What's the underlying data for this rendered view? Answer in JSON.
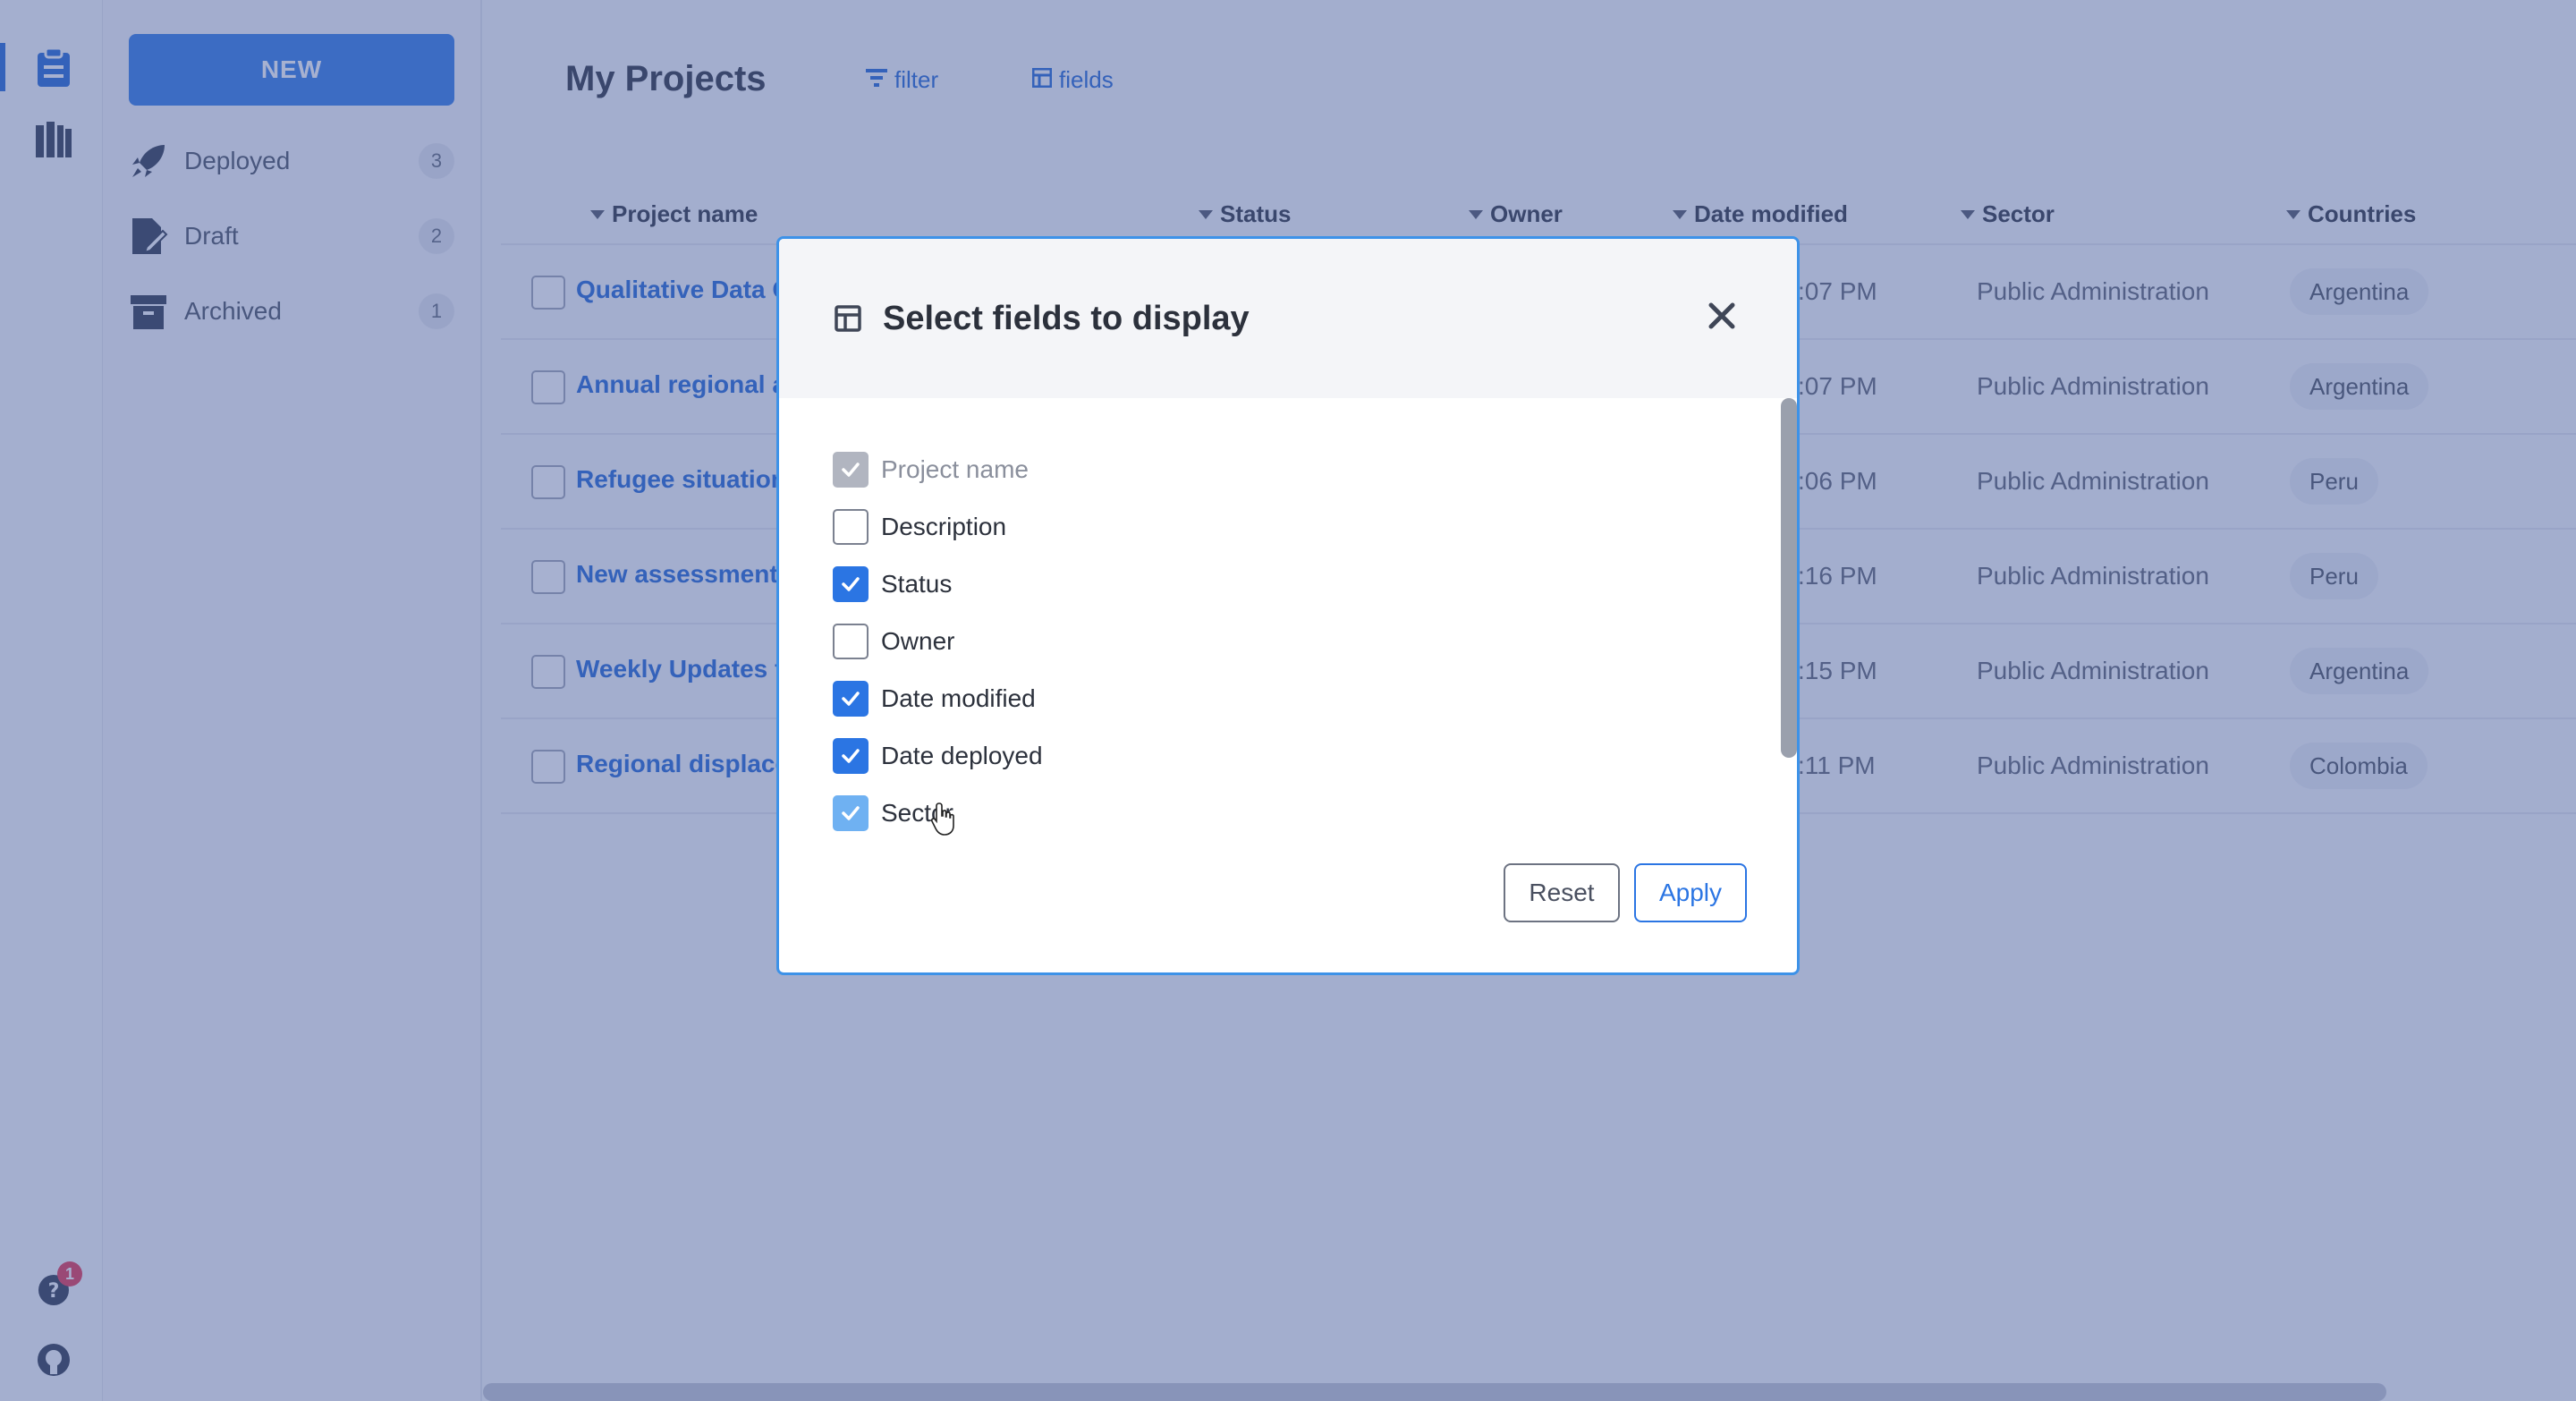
{
  "sidebar": {
    "new_label": "NEW",
    "items": [
      {
        "label": "Deployed",
        "count": "3",
        "icon": "rocket-icon"
      },
      {
        "label": "Draft",
        "count": "2",
        "icon": "draft-icon"
      },
      {
        "label": "Archived",
        "count": "1",
        "icon": "archive-icon"
      }
    ]
  },
  "rail": {
    "notification_count": "1"
  },
  "header": {
    "title": "My Projects",
    "filter_label": "filter",
    "fields_label": "fields"
  },
  "table": {
    "columns": [
      "Project name",
      "Status",
      "Owner",
      "Date modified",
      "Sector",
      "Countries"
    ],
    "rows": [
      {
        "name": "Qualitative Data C",
        "time": ":07 PM",
        "sector": "Public Administration",
        "country": "Argentina"
      },
      {
        "name": "Annual regional a",
        "time": ":07 PM",
        "sector": "Public Administration",
        "country": "Argentina"
      },
      {
        "name": "Refugee situation",
        "time": ":06 PM",
        "sector": "Public Administration",
        "country": "Peru"
      },
      {
        "name": "New assessment",
        "time": ":16 PM",
        "sector": "Public Administration",
        "country": "Peru"
      },
      {
        "name": "Weekly Updates f",
        "time": ":15 PM",
        "sector": "Public Administration",
        "country": "Argentina"
      },
      {
        "name": "Regional displace",
        "time": ":11 PM",
        "sector": "Public Administration",
        "country": "Colombia"
      }
    ]
  },
  "modal": {
    "title": "Select fields to display",
    "fields": [
      {
        "label": "Project name",
        "checked": true,
        "state": "disabled"
      },
      {
        "label": "Description",
        "checked": false,
        "state": "normal"
      },
      {
        "label": "Status",
        "checked": true,
        "state": "normal"
      },
      {
        "label": "Owner",
        "checked": false,
        "state": "normal"
      },
      {
        "label": "Date modified",
        "checked": true,
        "state": "normal"
      },
      {
        "label": "Date deployed",
        "checked": true,
        "state": "normal"
      },
      {
        "label": "Sector",
        "checked": true,
        "state": "hover"
      }
    ],
    "reset_label": "Reset",
    "apply_label": "Apply"
  },
  "colors": {
    "accent": "#2b75e3",
    "overlay": "#3c5296",
    "modal_border": "#3d92e8"
  }
}
